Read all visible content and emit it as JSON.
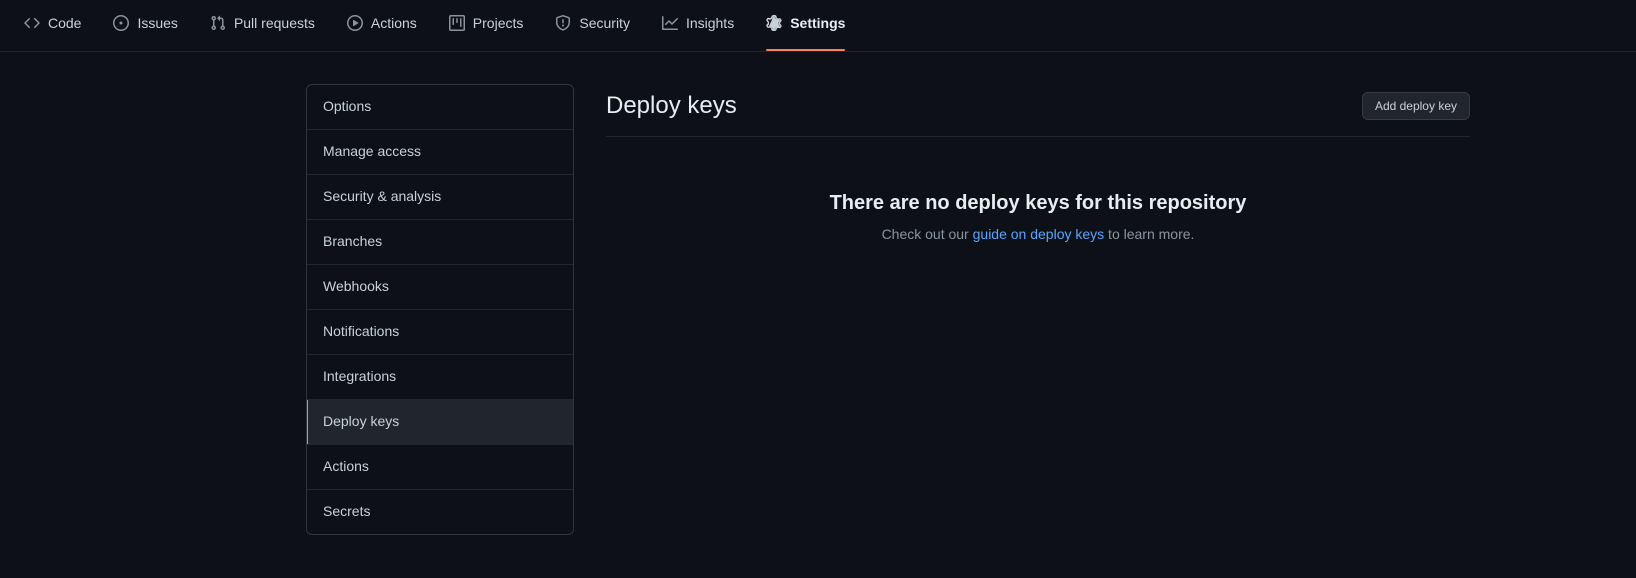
{
  "repo_nav": {
    "items": [
      {
        "label": "Code",
        "icon": "code-icon",
        "selected": false
      },
      {
        "label": "Issues",
        "icon": "issue-opened-icon",
        "selected": false
      },
      {
        "label": "Pull requests",
        "icon": "git-pull-request-icon",
        "selected": false
      },
      {
        "label": "Actions",
        "icon": "play-icon",
        "selected": false
      },
      {
        "label": "Projects",
        "icon": "project-icon",
        "selected": false
      },
      {
        "label": "Security",
        "icon": "shield-icon",
        "selected": false
      },
      {
        "label": "Insights",
        "icon": "graph-icon",
        "selected": false
      },
      {
        "label": "Settings",
        "icon": "gear-icon",
        "selected": true
      }
    ]
  },
  "settings_menu": {
    "items": [
      {
        "label": "Options",
        "selected": false
      },
      {
        "label": "Manage access",
        "selected": false
      },
      {
        "label": "Security & analysis",
        "selected": false
      },
      {
        "label": "Branches",
        "selected": false
      },
      {
        "label": "Webhooks",
        "selected": false
      },
      {
        "label": "Notifications",
        "selected": false
      },
      {
        "label": "Integrations",
        "selected": false
      },
      {
        "label": "Deploy keys",
        "selected": true
      },
      {
        "label": "Actions",
        "selected": false
      },
      {
        "label": "Secrets",
        "selected": false
      }
    ]
  },
  "main": {
    "title": "Deploy keys",
    "add_button_label": "Add deploy key",
    "blankslate": {
      "heading": "There are no deploy keys for this repository",
      "text_before": "Check out our ",
      "link_text": "guide on deploy keys",
      "text_after": " to learn more."
    }
  },
  "colors": {
    "background": "#0d1117",
    "accent_underline": "#f78166",
    "link": "#58a6ff",
    "border": "#21262d",
    "selected_row": "#21262d"
  }
}
